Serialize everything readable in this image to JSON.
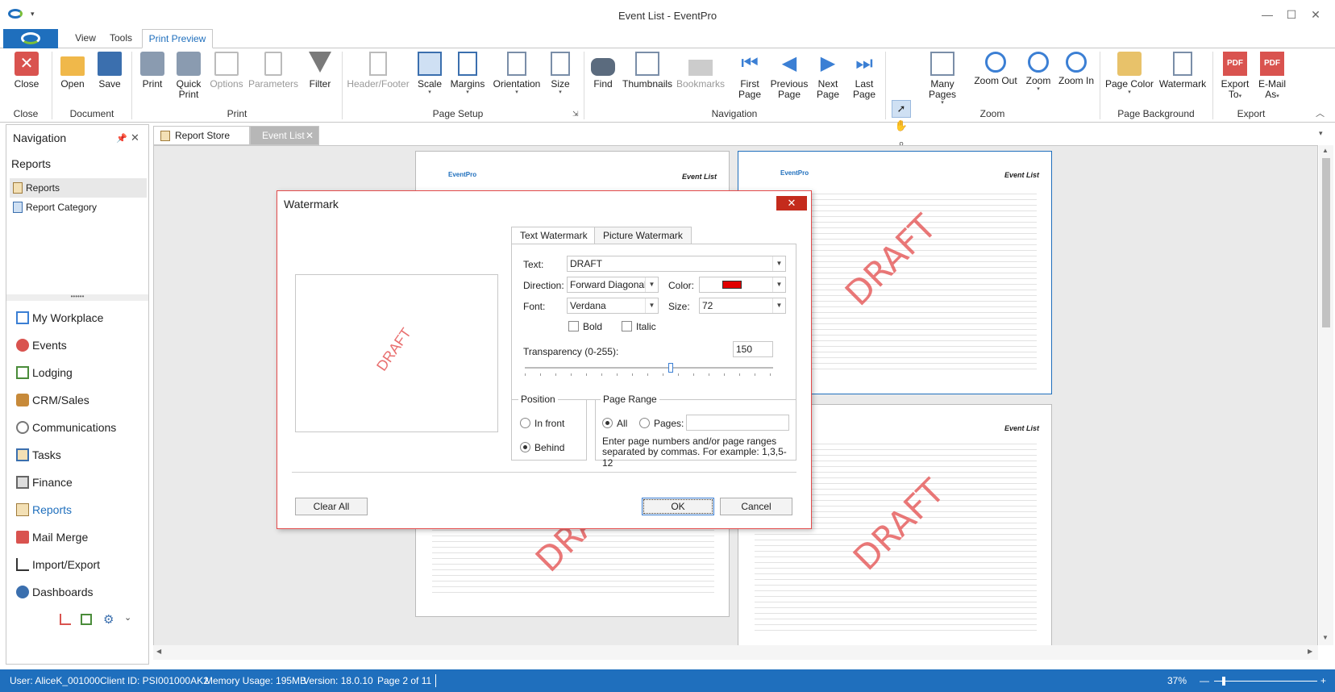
{
  "window": {
    "title": "Event List - EventPro"
  },
  "ribbon_tabs": [
    "View",
    "Tools",
    "Print Preview"
  ],
  "ribbon": {
    "close": "Close",
    "open": "Open",
    "save": "Save",
    "print": "Print",
    "quick_print_1": "Quick",
    "quick_print_2": "Print",
    "options": "Options",
    "parameters": "Parameters",
    "filter": "Filter",
    "header_footer": "Header/Footer",
    "scale": "Scale",
    "margins": "Margins",
    "orientation": "Orientation",
    "size": "Size",
    "find": "Find",
    "thumbnails": "Thumbnails",
    "bookmarks": "Bookmarks",
    "first_page_1": "First",
    "first_page_2": "Page",
    "previous_page_1": "Previous",
    "previous_page_2": "Page",
    "next_page_1": "Next",
    "next_page_2": "Page",
    "last_page_1": "Last",
    "last_page_2": "Page",
    "many_pages": "Many Pages",
    "zoom_out": "Zoom Out",
    "zoom": "Zoom",
    "zoom_in": "Zoom In",
    "page_color": "Page Color",
    "watermark": "Watermark",
    "export_to_1": "Export",
    "export_to_2": "To",
    "email_as_1": "E-Mail",
    "email_as_2": "As",
    "groups": {
      "close": "Close",
      "document": "Document",
      "print": "Print",
      "page_setup": "Page Setup",
      "navigation": "Navigation",
      "zoom": "Zoom",
      "page_background": "Page Background",
      "export": "Export"
    }
  },
  "nav": {
    "title": "Navigation",
    "section": "Reports",
    "sub_items": [
      "Reports",
      "Report Category"
    ],
    "items": [
      "My Workplace",
      "Events",
      "Lodging",
      "CRM/Sales",
      "Communications",
      "Tasks",
      "Finance",
      "Reports",
      "Mail Merge",
      "Import/Export",
      "Dashboards"
    ]
  },
  "doc_tabs": [
    "Report Store",
    "Event List"
  ],
  "pages": {
    "logo": "EventPro",
    "title": "Event List",
    "watermark": "DRAFT"
  },
  "dialog": {
    "title": "Watermark",
    "preview_text": "DRAFT",
    "tab_text": "Text Watermark",
    "tab_picture": "Picture Watermark",
    "text_label": "Text:",
    "text_value": "DRAFT",
    "direction_label": "Direction:",
    "direction_value": "Forward Diagonal",
    "color_label": "Color:",
    "color_value": "#e00000",
    "font_label": "Font:",
    "font_value": "Verdana",
    "size_label": "Size:",
    "size_value": "72",
    "bold_label": "Bold",
    "italic_label": "Italic",
    "transparency_label": "Transparency (0-255):",
    "transparency_value": "150",
    "transparency_fraction": 0.588,
    "position_legend": "Position",
    "in_front": "In front",
    "behind": "Behind",
    "range_legend": "Page Range",
    "all": "All",
    "pages": "Pages:",
    "pages_value": "",
    "hint_1": "Enter page numbers and/or page ranges",
    "hint_2": "separated by commas. For example: 1,3,5-12",
    "clear_all": "Clear All",
    "ok": "OK",
    "cancel": "Cancel"
  },
  "status": {
    "user": "User: AliceK_001000",
    "client": "Client ID: PSI001000AK2",
    "memory": "Memory Usage: 195MB",
    "version": "Version: 18.0.10",
    "page": "Page 2 of 11",
    "zoom": "37%"
  }
}
